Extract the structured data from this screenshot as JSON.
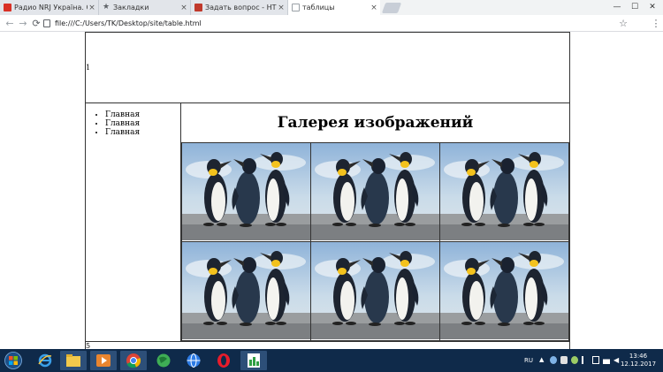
{
  "browser": {
    "tabs": [
      {
        "title": "Радио NRJ Україна. Слу",
        "favicon_color": "#d93025"
      },
      {
        "title": "Закладки",
        "favicon_color": "#5f6368"
      },
      {
        "title": "Задать вопрос - HTML",
        "favicon_color": "#c0392b"
      },
      {
        "title": "таблицы",
        "favicon_color": "#9aa0a6"
      }
    ],
    "close_glyph": "×",
    "address": "file:///C:/Users/TK/Desktop/site/table.html",
    "window_buttons": {
      "minimize": "—",
      "maximize": "☐",
      "close": "✕"
    },
    "nav": {
      "back": "←",
      "forward": "→",
      "reload": "⟳",
      "star": "☆",
      "menu": "⋮"
    }
  },
  "page": {
    "header_text": "1",
    "nav_items": [
      "Главная",
      "Главная",
      "Главная"
    ],
    "gallery_title": "Галерея изображений",
    "gallery_rows": 2,
    "gallery_cols": 3,
    "footer_text": "5"
  },
  "taskbar": {
    "language": "RU",
    "time": "13:46",
    "date": "12.12.2017",
    "pinned_icons": [
      "internet-explorer-icon",
      "file-explorer-icon",
      "media-player-icon",
      "chrome-icon",
      "globe-app-icon",
      "network-icon",
      "opera-icon",
      "spreadsheet-app-icon"
    ]
  },
  "colors": {
    "taskbar": "#0f2a4a",
    "tab_active": "#ffffff",
    "tab_inactive": "#e2e5ea"
  }
}
